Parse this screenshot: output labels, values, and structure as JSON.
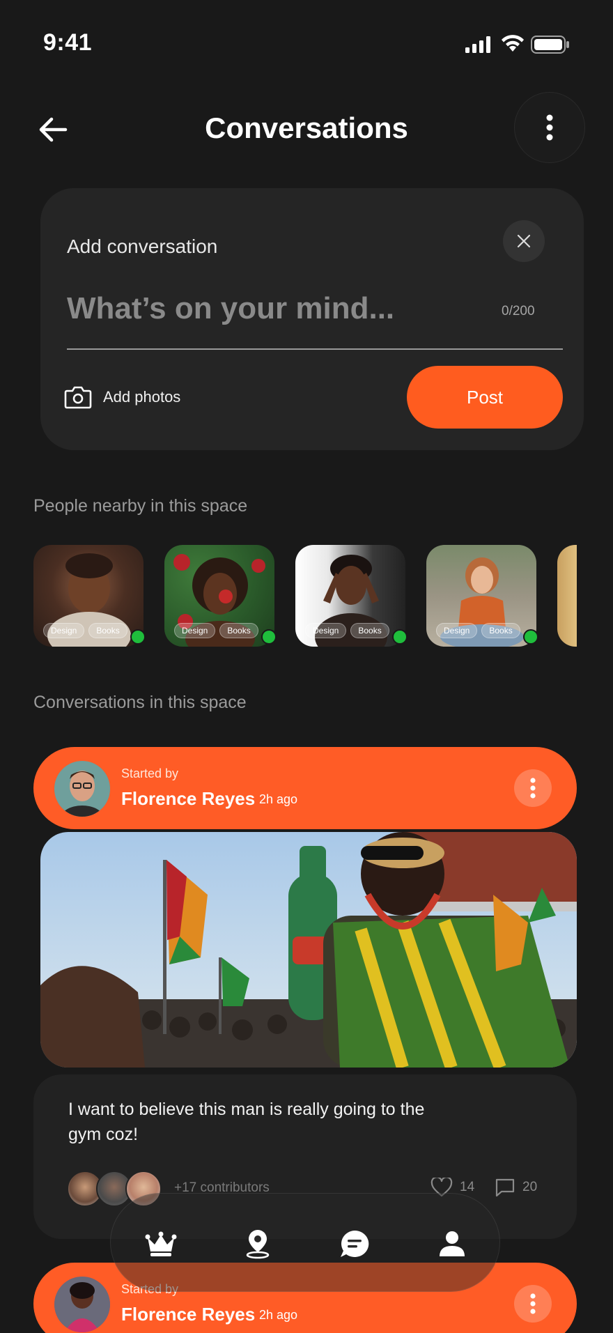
{
  "status_bar": {
    "time": "9:41"
  },
  "header": {
    "title": "Conversations"
  },
  "composer": {
    "title": "Add conversation",
    "placeholder": "What’s on your mind...",
    "char_count": "0/200",
    "add_photos_label": "Add photos",
    "post_label": "Post"
  },
  "people_section": {
    "label": "People nearby in this space",
    "people": [
      {
        "tags": [
          "Design",
          "Books"
        ],
        "online": true
      },
      {
        "tags": [
          "Design",
          "Books"
        ],
        "online": true
      },
      {
        "tags": [
          "Design",
          "Books"
        ],
        "online": true
      },
      {
        "tags": [
          "Design",
          "Books"
        ],
        "online": true
      }
    ]
  },
  "conversations_section": {
    "label": "Conversations in this space",
    "items": [
      {
        "started_by_label": "Started by",
        "author": "Florence Reyes",
        "time_ago": "2h ago",
        "text": "I want to believe this man is really going to the gym coz!",
        "contributors": "+17 contributors",
        "likes": "14",
        "comments": "20"
      },
      {
        "started_by_label": "Started by",
        "author": "Florence Reyes",
        "time_ago": "2h ago"
      }
    ]
  },
  "bottom_nav": {
    "items": [
      {
        "icon": "crown-icon"
      },
      {
        "icon": "map-pin-icon"
      },
      {
        "icon": "chat-icon"
      },
      {
        "icon": "profile-icon"
      }
    ]
  },
  "colors": {
    "background": "#191919",
    "card": "#252525",
    "accent": "#ff5c26",
    "online": "#1fbe3c"
  }
}
